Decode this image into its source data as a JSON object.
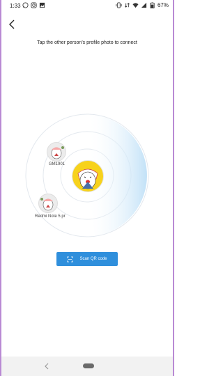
{
  "status_bar": {
    "time": "1:33",
    "battery": "67%",
    "icons_left": [
      "whatsapp-icon",
      "instagram-icon",
      "gallery-icon"
    ],
    "icons_right": [
      "vibrate-icon",
      "data-icon",
      "wifi-icon",
      "signal-icon",
      "battery-icon"
    ]
  },
  "header": {
    "back_icon": "back-arrow-icon",
    "instruction": "Tap the other person's profile photo to connect"
  },
  "radar": {
    "self_avatar": "self-avatar",
    "devices": [
      {
        "label": "GM1901"
      },
      {
        "label": "Redmi Note 5 pr"
      }
    ]
  },
  "scan": {
    "label": "Scan QR code",
    "icon": "scan-qr-icon"
  },
  "nav": {
    "back_icon": "nav-back-icon",
    "home": "home-pill"
  },
  "colors": {
    "accent": "#2f8fdc",
    "sweep": "#bfe0f7",
    "ring": "#e3e8ee",
    "avatar_bg": "#f7d21c"
  }
}
